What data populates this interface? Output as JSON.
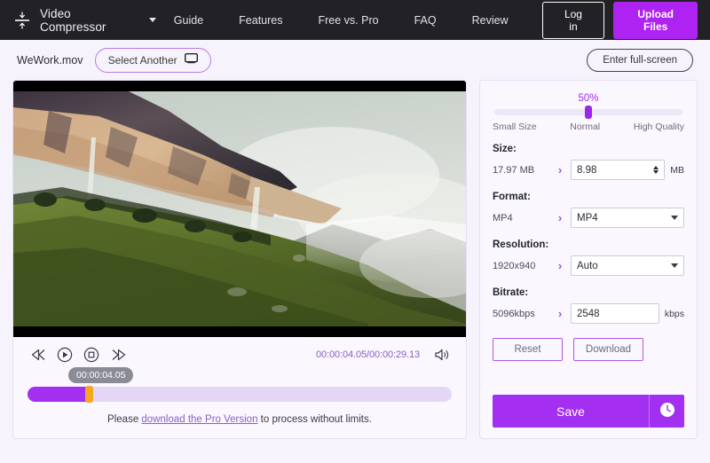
{
  "topnav": {
    "logo_icon": "compress-vertical-icon",
    "brand": "Video Compressor",
    "caret_icon": "chevron-down-icon",
    "links": [
      {
        "label": "Guide"
      },
      {
        "label": "Features"
      },
      {
        "label": "Free vs. Pro"
      },
      {
        "label": "FAQ"
      },
      {
        "label": "Review"
      }
    ],
    "login_label": "Log in",
    "upload_label": "Upload Files",
    "bg_color": "#212126",
    "accent_color": "#ae22f2"
  },
  "subheader": {
    "filename": "WeWork.mov",
    "select_another_label": "Select Another",
    "select_another_icon": "monitor-icon",
    "fullscreen_label": "Enter full-screen"
  },
  "player": {
    "controls": [
      {
        "name": "rewind-button",
        "icon": "rewind-icon"
      },
      {
        "name": "play-button",
        "icon": "play-circle-icon"
      },
      {
        "name": "stop-button",
        "icon": "stop-circle-icon"
      },
      {
        "name": "forward-button",
        "icon": "fast-forward-icon"
      }
    ],
    "current_time": "00:00:04.05",
    "total_time": "00:00:29.13",
    "time_display": "00:00:04.05/00:00:29.13",
    "volume_icon": "volume-icon",
    "tooltip_time": "00:00:04.05",
    "progress_percent": 14,
    "progress_fill_color": "#a32ff0",
    "progress_handle_color": "#f5a623",
    "pro_note_prefix": "Please ",
    "pro_note_link": "download the Pro Version",
    "pro_note_suffix": " to process without limits."
  },
  "settings": {
    "quality_percent": "50%",
    "quality_value": 50,
    "slider_labels": {
      "left": "Small Size",
      "center": "Normal",
      "right": "High Quality"
    },
    "size": {
      "label": "Size:",
      "original": "17.97 MB",
      "arrow": "›",
      "value": "8.98",
      "unit": "MB"
    },
    "format": {
      "label": "Format:",
      "original": "MP4",
      "arrow": "›",
      "value": "MP4"
    },
    "resolution": {
      "label": "Resolution:",
      "original": "1920x940",
      "arrow": "›",
      "value": "Auto"
    },
    "bitrate": {
      "label": "Bitrate:",
      "original": "5096kbps",
      "arrow": "›",
      "value": "2548",
      "unit": "kbps"
    },
    "reset_label": "Reset",
    "download_label": "Download",
    "save_label": "Save",
    "history_icon": "clock-icon"
  }
}
